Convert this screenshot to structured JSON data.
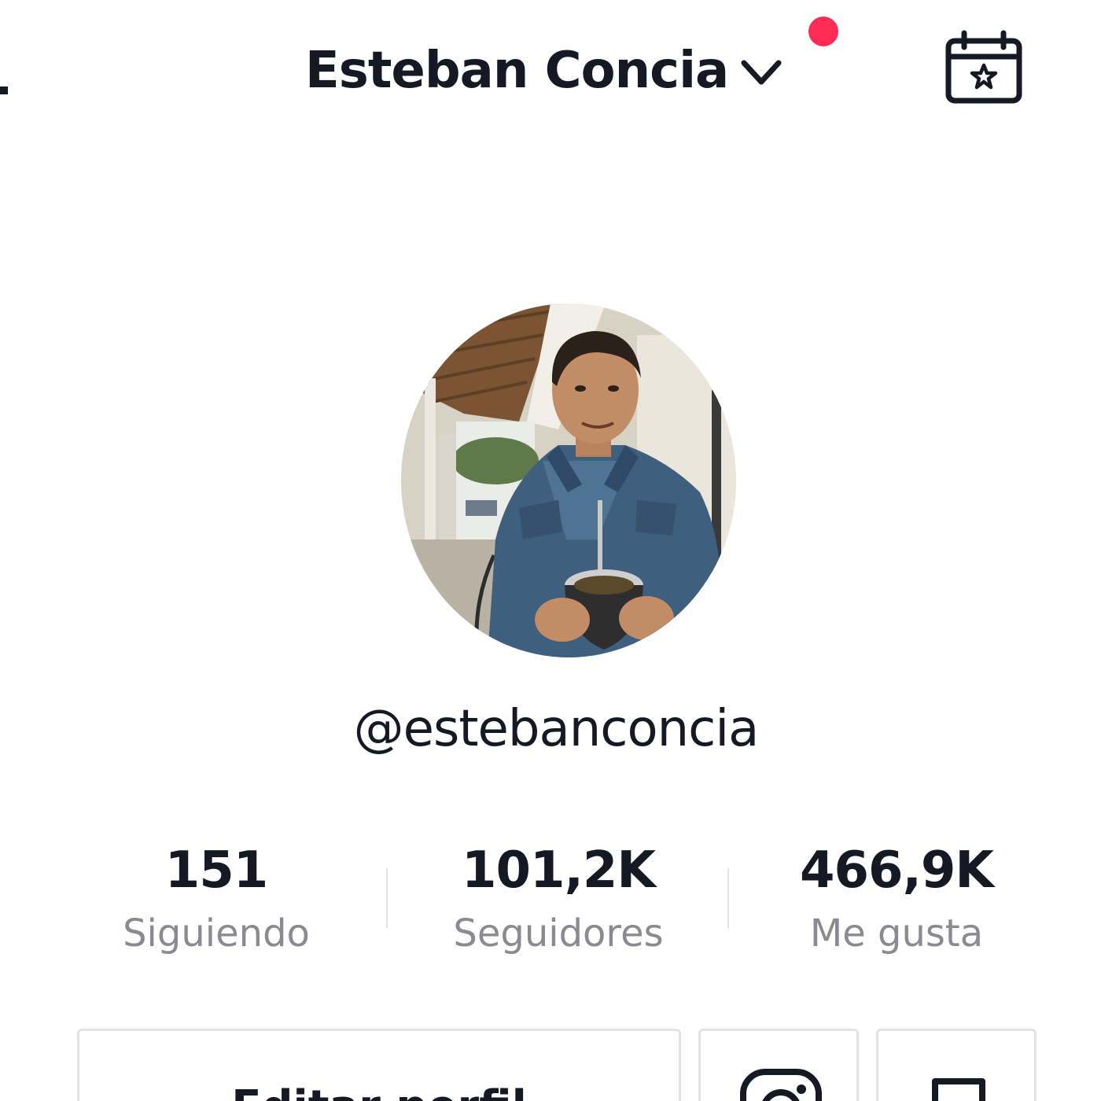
{
  "header": {
    "account_name": "Esteban Concia",
    "has_notification": true,
    "notification_color": "#fe2c55",
    "switcher_icon": "chevron-down-icon",
    "right_icon": "calendar-star-icon"
  },
  "profile": {
    "avatar_alt": "profile photo",
    "username": "@estebanconcia"
  },
  "stats": {
    "following": {
      "value": "151",
      "label": "Siguiendo"
    },
    "followers": {
      "value": "101,2K",
      "label": "Seguidores"
    },
    "likes": {
      "value": "466,9K",
      "label": "Me gusta"
    }
  },
  "actions": {
    "edit_profile_label": "Editar perfil",
    "instagram_icon": "instagram-icon",
    "bookmark_icon": "bookmark-icon"
  },
  "colors": {
    "text_primary": "#161823",
    "text_secondary": "#8a8b91",
    "accent": "#fe2c55",
    "border": "#e3e3e4"
  }
}
